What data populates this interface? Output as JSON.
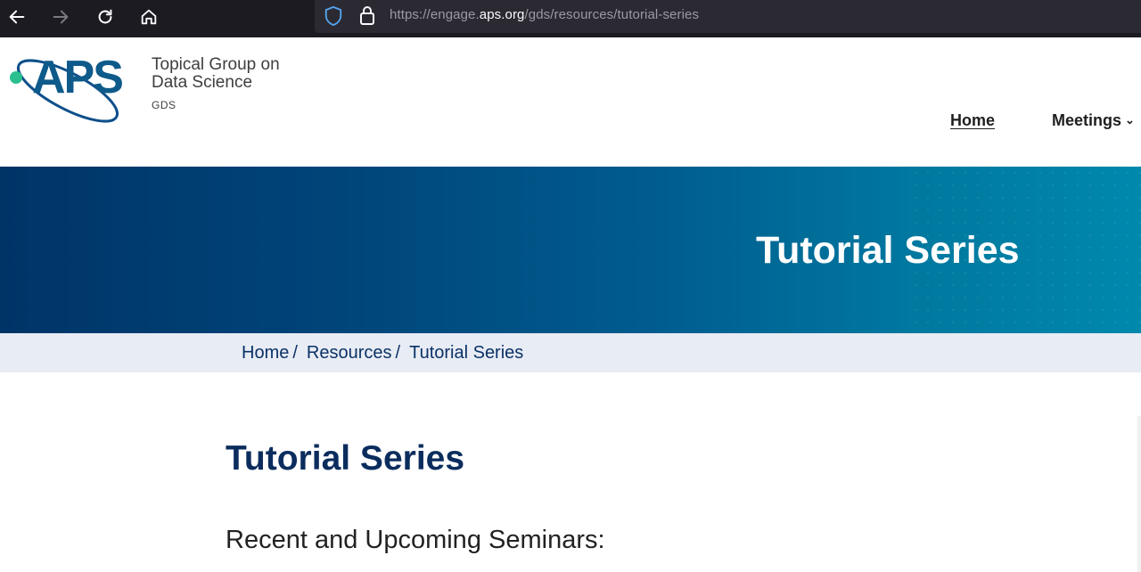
{
  "browser": {
    "url_prefix": "https://engage.",
    "url_domain": "aps.org",
    "url_path": "/gds/resources/tutorial-series"
  },
  "header": {
    "logo_text": "APS",
    "group_line1": "Topical Group on",
    "group_line2": "Data Science",
    "group_abbr": "GDS",
    "nav": {
      "home": "Home",
      "meetings": "Meetings"
    }
  },
  "hero": {
    "title": "Tutorial Series"
  },
  "breadcrumb": {
    "items": [
      "Home",
      "Resources",
      "Tutorial Series"
    ],
    "separator": "/"
  },
  "main": {
    "title": "Tutorial Series",
    "section_heading": "Recent and Upcoming Seminars:"
  },
  "colors": {
    "brand_navy": "#0b2d5e",
    "brand_blue": "#0e5a8a",
    "accent_green": "#2bbf8f",
    "breadcrumb_bg": "#e8ecf4"
  }
}
